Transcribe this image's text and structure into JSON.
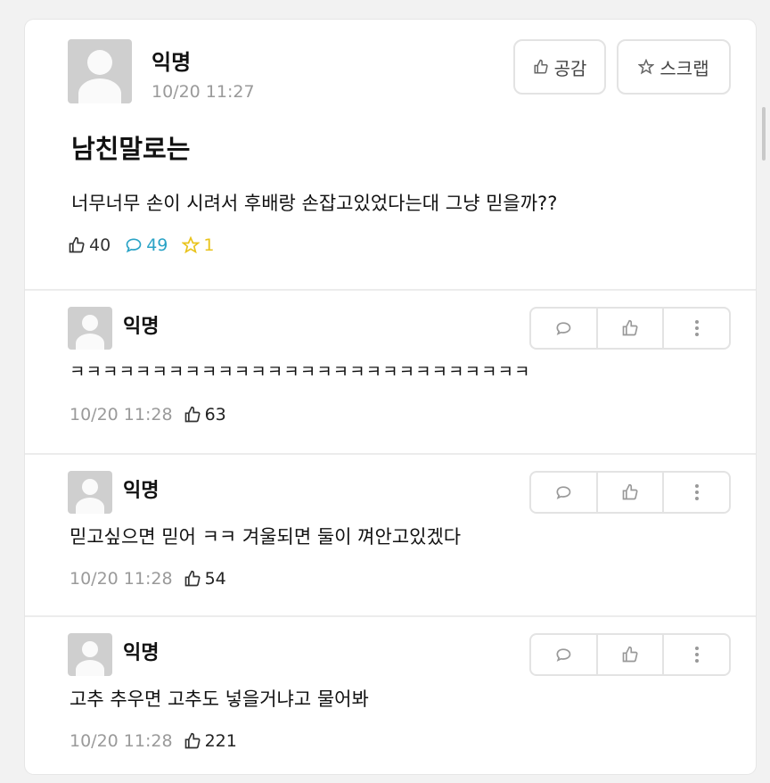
{
  "post": {
    "author": "익명",
    "time": "10/20 11:27",
    "title": "남친말로는",
    "body": "너무너무 손이 시려서 후배랑 손잡고있었다는대 그냥 믿을까??",
    "likes": "40",
    "comments": "49",
    "scraps": "1",
    "like_button": "공감",
    "scrap_button": "스크랩"
  },
  "comments": [
    {
      "author": "익명",
      "text": "ㅋㅋㅋㅋㅋㅋㅋㅋㅋㅋㅋㅋㅋㅋㅋㅋㅋㅋㅋㅋㅋㅋㅋㅋㅋㅋㅋㅋ",
      "time": "10/20 11:28",
      "likes": "63"
    },
    {
      "author": "익명",
      "text": "믿고싶으면 믿어 ㅋㅋ 겨울되면 둘이 껴안고있겠다",
      "time": "10/20 11:28",
      "likes": "54"
    },
    {
      "author": "익명",
      "text": "고추 추우면 고추도 넣을거냐고 물어봐",
      "time": "10/20 11:28",
      "likes": "221"
    }
  ],
  "colors": {
    "like": "#e23c2e",
    "comment": "#2aa3c6",
    "scrap": "#e9c31c",
    "meta": "#9a9a9a"
  },
  "icons": {
    "like": "thumbs-up-icon",
    "comment": "speech-bubble-icon",
    "scrap": "star-icon",
    "more": "vertical-dots-icon"
  }
}
